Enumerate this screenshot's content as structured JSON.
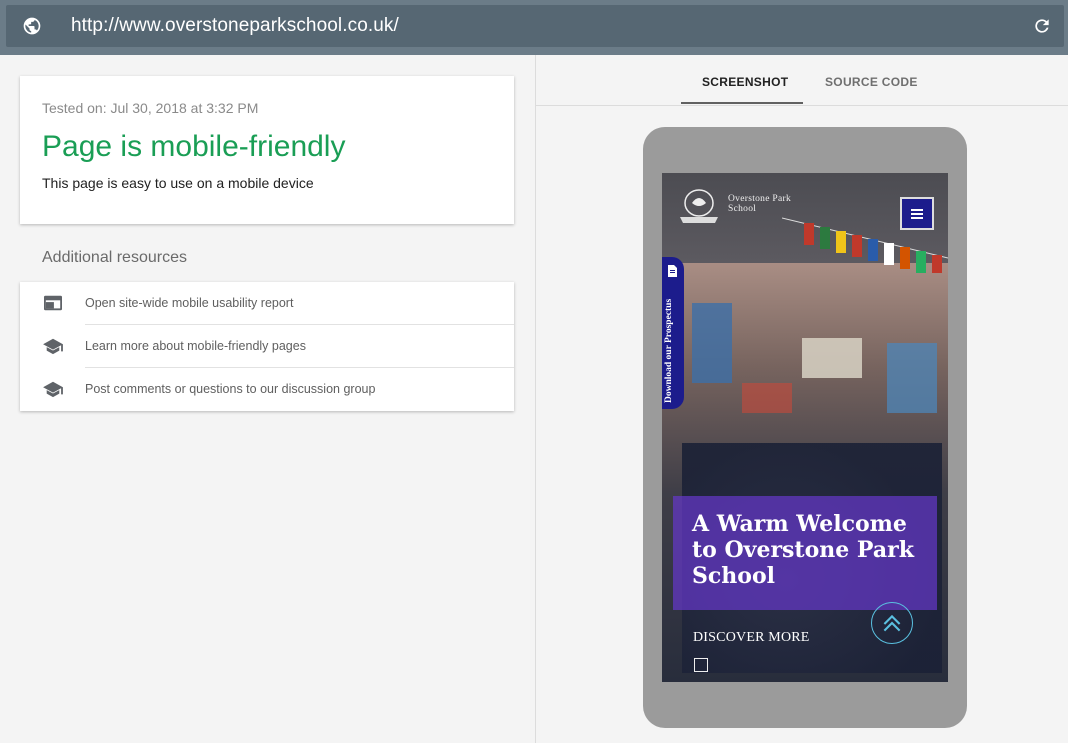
{
  "browser": {
    "url": "http://www.overstoneparkschool.co.uk/"
  },
  "result": {
    "tested_on": "Tested on: Jul 30, 2018 at 3:32 PM",
    "headline": "Page is mobile-friendly",
    "subtitle": "This page is easy to use on a mobile device",
    "headline_color": "#1a9e55"
  },
  "resources": {
    "title": "Additional resources",
    "items": [
      {
        "label": "Open site-wide mobile usability report",
        "icon": "browser-window-icon"
      },
      {
        "label": "Learn more about mobile-friendly pages",
        "icon": "graduation-cap-icon"
      },
      {
        "label": "Post comments or questions to our discussion group",
        "icon": "graduation-cap-icon"
      }
    ]
  },
  "tabs": {
    "screenshot": "SCREENSHOT",
    "source": "SOURCE CODE",
    "active": "SCREENSHOT"
  },
  "preview": {
    "school_name_line1": "Overstone Park",
    "school_name_line2": "School",
    "prospectus": "Download our Prospectus",
    "welcome": "A Warm Welcome to Overstone Park School",
    "discover": "DISCOVER MORE",
    "brand_color": "#1c1c8c"
  }
}
